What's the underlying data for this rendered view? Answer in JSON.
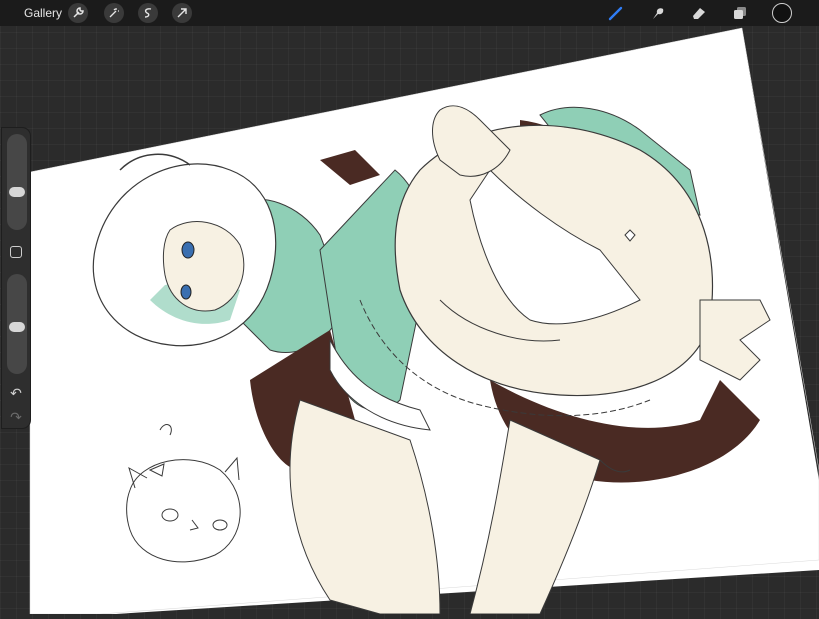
{
  "topbar": {
    "gallery_label": "Gallery",
    "left_tools": [
      "wrench-icon",
      "magic-wand-icon",
      "selection-icon",
      "transform-arrow-icon"
    ],
    "right_tools": [
      "brush-icon",
      "smudge-icon",
      "eraser-icon",
      "layers-icon"
    ],
    "active_tool": "brush-icon",
    "active_color": "#111111",
    "accent": "#2f7df6"
  },
  "sidebar": {
    "brush_size_level": 0.62,
    "opacity_level": 0.48,
    "modify_icon": "square-icon",
    "undo_icon": "undo-arrow-icon",
    "redo_icon": "redo-arrow-icon"
  },
  "canvas": {
    "subject": "illustration-maid-character",
    "palette": {
      "paper": "#ffffff",
      "skin": "#f7f1e3",
      "mint": "#8fcfb6",
      "brown": "#4a2a23",
      "line": "#3a3a3a",
      "eye": "#3a6fb0"
    }
  }
}
